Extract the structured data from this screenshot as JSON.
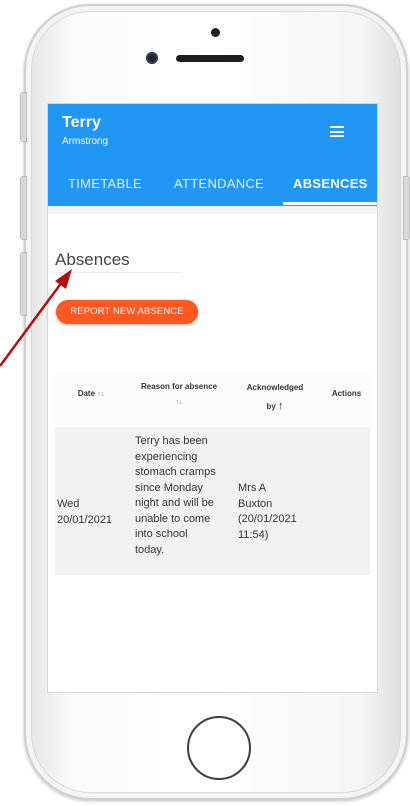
{
  "user": {
    "first_name": "Terry",
    "last_name": "Armstrong"
  },
  "tabs": [
    {
      "label": "TIMETABLE",
      "active": false
    },
    {
      "label": "ATTENDANCE",
      "active": false
    },
    {
      "label": "ABSENCES",
      "active": true
    }
  ],
  "page": {
    "title": "Absences",
    "report_button": "REPORT NEW ABSENCE"
  },
  "table": {
    "headers": {
      "date": "Date",
      "reason": "Reason for absence",
      "acknowledged": "Acknowledged",
      "acknowledged_by": "by",
      "actions": "Actions"
    },
    "sort_icons": {
      "unsorted": "↑↓",
      "sorted_asc": "↑"
    },
    "rows": [
      {
        "date_line1": "Wed",
        "date_line2": "20/01/2021",
        "reason_lines": [
          "Terry has been",
          "experiencing",
          "stomach cramps",
          "since Monday",
          "night and will be",
          "unable to come",
          "into school",
          "today."
        ],
        "ack_lines": [
          "Mrs A",
          "Buxton",
          "(20/01/2021",
          "11:54)"
        ]
      }
    ]
  },
  "colors": {
    "app_bar": "#2196f3",
    "report_button": "#ff5722",
    "annotation_arrow": "#b01010"
  },
  "icons": {
    "menu": "hamburger-menu-icon",
    "sort": "sort-arrows-icon",
    "sorted": "arrow-up-icon"
  }
}
